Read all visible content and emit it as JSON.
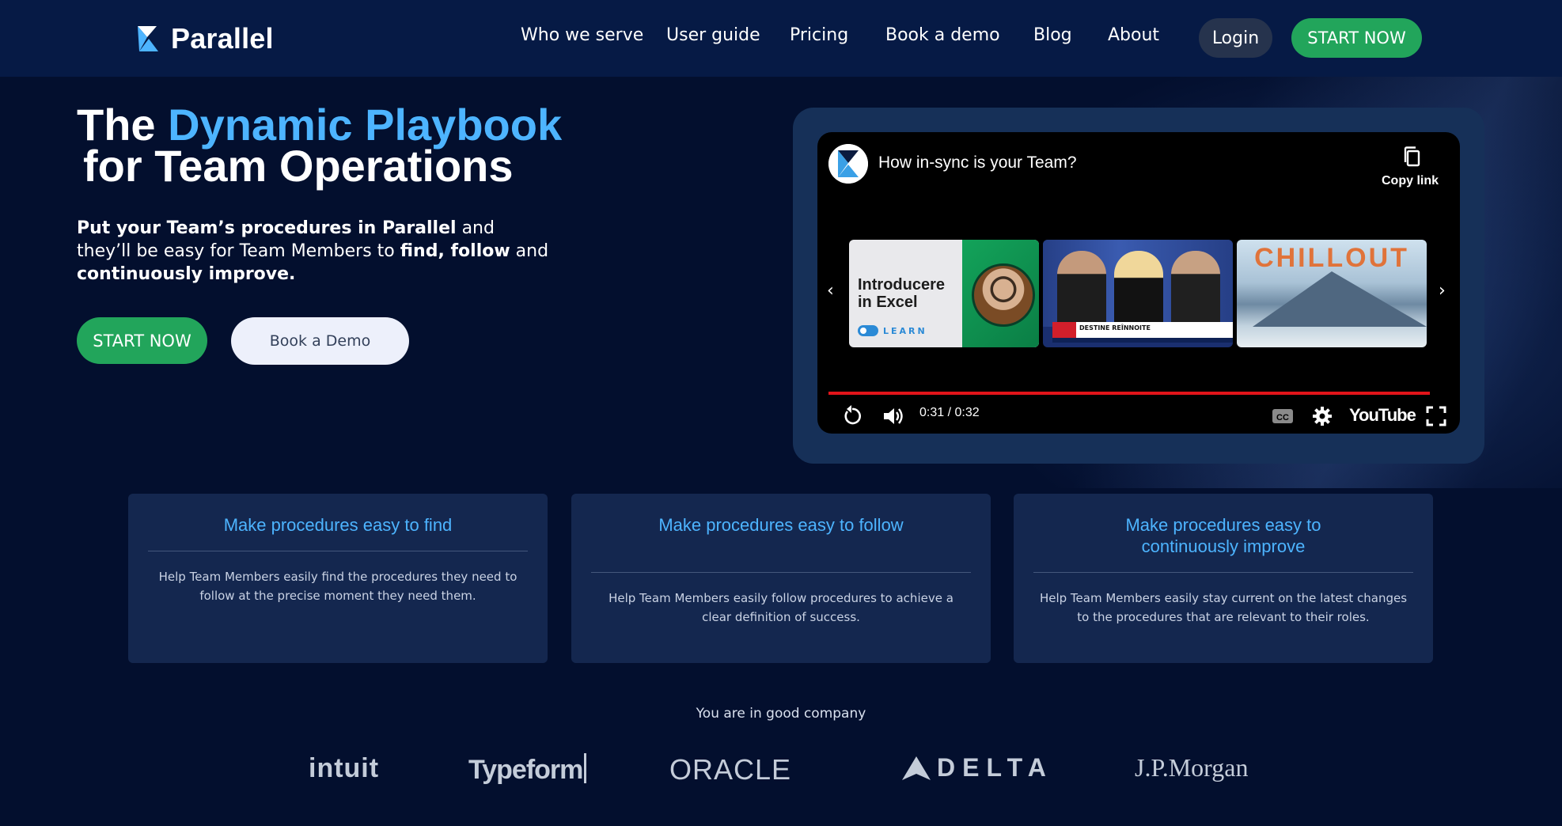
{
  "header": {
    "brand": "Parallel",
    "nav": [
      "Who we serve",
      "User guide",
      "Pricing",
      "Book a demo",
      "Blog",
      "About"
    ],
    "login": "Login",
    "start": "START NOW"
  },
  "hero": {
    "title_prefix": "The ",
    "title_accent": "Dynamic Playbook",
    "title_line2": "for Team Operations",
    "sub_b1": "Put your Team’s procedures in Parallel",
    "sub_t1": " and they’ll be easy for Team Members to ",
    "sub_b2": "find, follow",
    "sub_t2": " and ",
    "sub_b3": "continuously improve.",
    "start_button": "START NOW",
    "demo_button": "Book a Demo"
  },
  "video": {
    "title": "How in-sync is your Team?",
    "copy_link": "Copy link",
    "time": "0:31 / 0:32",
    "youtube": "YouTube",
    "thumbs": {
      "t1_title": "Introducere in Excel",
      "t1_badge": "LEARN",
      "t2_ticker": "DESTINE REÎNNOITE",
      "t3_title": "CHILLOUT"
    },
    "progress": 0.97
  },
  "features": [
    {
      "title": "Make procedures easy to find",
      "text": "Help Team Members easily find the procedures they need to follow at the precise moment they need them."
    },
    {
      "title": "Make procedures easy to follow",
      "text": "Help Team Members easily follow procedures to achieve a clear definition of success."
    },
    {
      "title": "Make procedures easy to continuously improve",
      "text": "Help Team Members easily stay current on the latest changes to the procedures that are relevant to their roles."
    }
  ],
  "companies": {
    "label": "You are in good company",
    "logos": [
      "intuit",
      "Typeform",
      "ORACLE",
      "DELTA",
      "J.P.Morgan"
    ]
  },
  "colors": {
    "background": "#030f2e",
    "header": "#061a45",
    "accent_blue": "#4db4ff",
    "cta_green": "#22a55b",
    "card": "#14274f"
  }
}
